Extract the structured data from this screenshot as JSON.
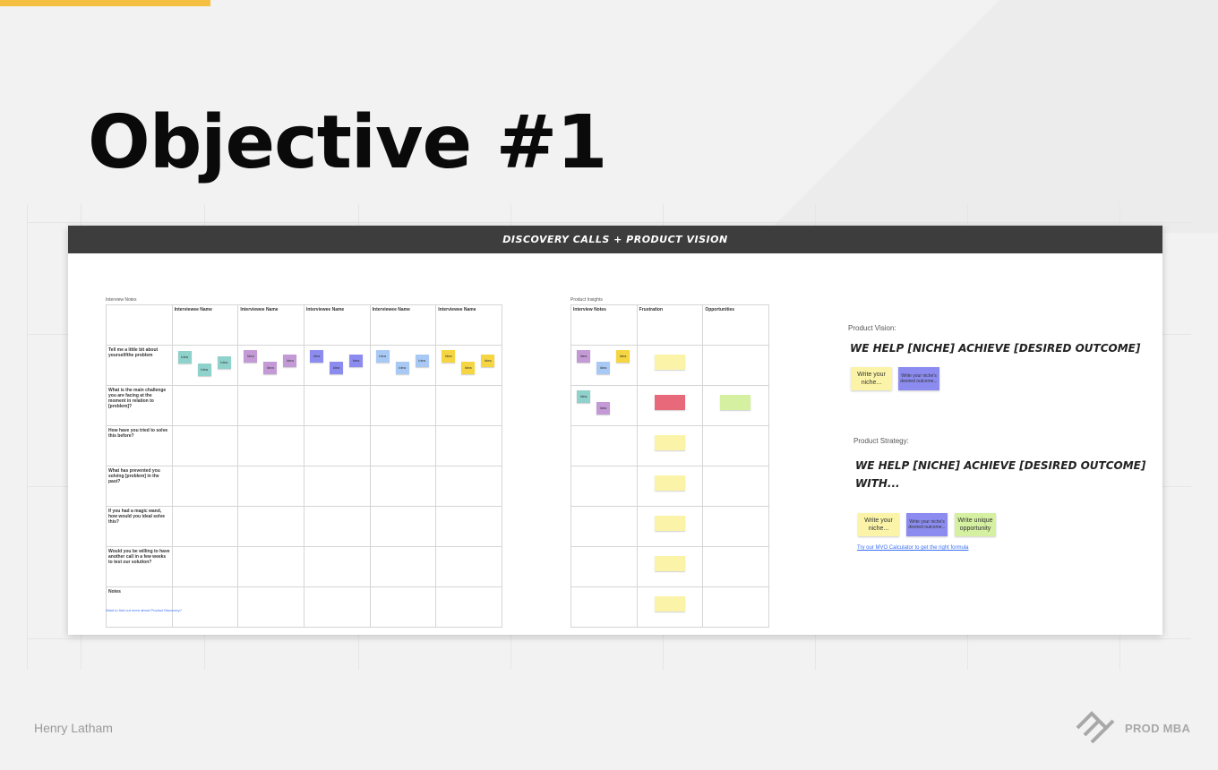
{
  "slide": {
    "title": "Objective #1",
    "author": "Henry Latham",
    "brand": "PROD MBA",
    "accent_color": "#f5c042"
  },
  "board": {
    "header": "DISCOVERY CALLS + PRODUCT VISION",
    "interview": {
      "label": "Interview Notes",
      "columns": [
        "Interviewee Name",
        "Interviewee Name",
        "Interviewee Name",
        "Interviewee Name",
        "Interviewee Name"
      ],
      "questions": [
        "Tell me a little bit about yourself/the problem",
        "What is the main challenge you are facing at the moment in relation to [problem]?",
        "How have you tried to solve this before?",
        "What has prevented you solving [problem] in the past?",
        "If you had a magic wand, how would you ideal solve this?",
        "Would you be willing to have another call in a few weeks to test our solution?",
        "Notes"
      ],
      "sticky_label": "Idea",
      "sticky_colors": [
        "#8fd1cb",
        "#c39ad6",
        "#8c8cf0",
        "#a9c9f5",
        "#f5d542"
      ],
      "footer_link": "Want to find out more about Product Discovery?"
    },
    "insights": {
      "label": "Product Insights",
      "columns": [
        "Interview Notes",
        "Frustration",
        "Opportunities"
      ],
      "sticky_label": "Idea"
    },
    "vision": {
      "label": "Product Vision:",
      "statement": "WE HELP [NICHE] ACHIEVE [DESIRED OUTCOME]",
      "notes": [
        "Write your niche...",
        "Write your niche's desired outcome..."
      ]
    },
    "strategy": {
      "label": "Product Strategy:",
      "statement_line1": "WE HELP [NICHE] ACHIEVE [DESIRED OUTCOME]",
      "statement_line2": "WITH...",
      "notes": [
        "Write your niche...",
        "Write your niche's desired outcome...",
        "Write unique opportunity"
      ],
      "link": "Try our MVO Calculator to get the right formula"
    }
  }
}
